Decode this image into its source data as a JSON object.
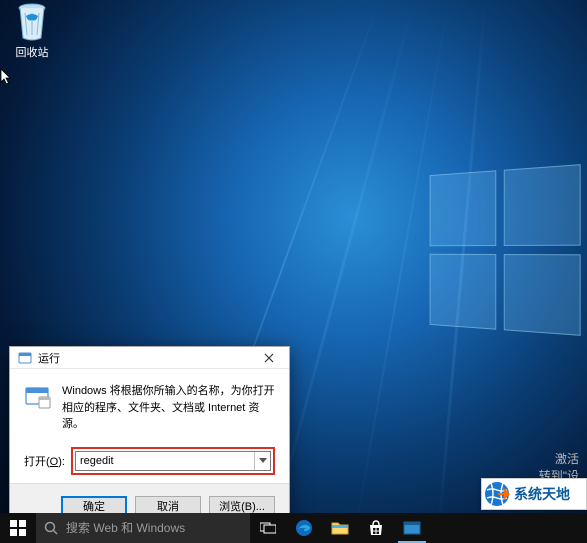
{
  "desktop": {
    "icons": [
      {
        "id": "recycle-bin",
        "label": "回收站"
      }
    ],
    "activation": {
      "line1": "激活",
      "line2": "转到\"设"
    }
  },
  "run_dialog": {
    "title": "运行",
    "message": "Windows 将根据你所输入的名称，为你打开相应的程序、文件夹、文档或 Internet 资源。",
    "open_label_prefix": "打开(",
    "open_label_hotkey": "O",
    "open_label_suffix": "):",
    "input_value": "regedit",
    "buttons": {
      "ok": "确定",
      "cancel": "取消",
      "browse": "浏览(B)..."
    }
  },
  "taskbar": {
    "search_placeholder": "搜索 Web 和 Windows",
    "items": [
      {
        "id": "task-view",
        "active": false
      },
      {
        "id": "edge",
        "active": false
      },
      {
        "id": "file-explorer",
        "active": false
      },
      {
        "id": "store",
        "active": false
      },
      {
        "id": "app-running",
        "active": true
      }
    ]
  },
  "badge": {
    "text": "系统天地"
  }
}
